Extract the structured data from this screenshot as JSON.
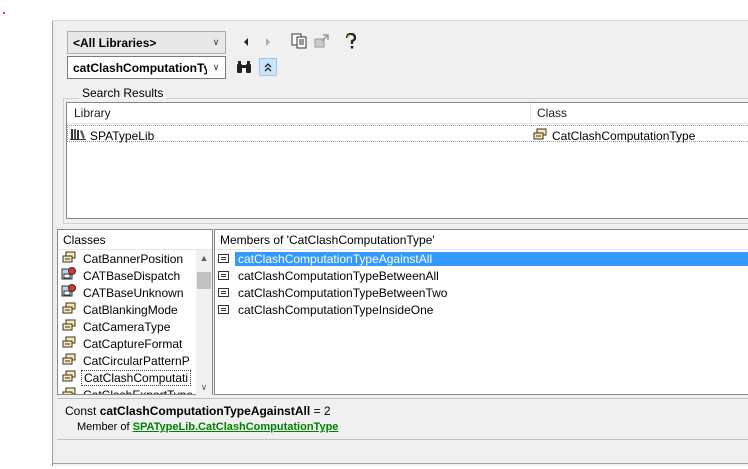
{
  "toolbar": {
    "library_combo_value": "<All Libraries>",
    "search_combo_value": "catClashComputationTyp",
    "nav_back_icon": "back-arrow-icon",
    "nav_forward_icon": "forward-arrow-icon",
    "copy_icon": "copy-to-clipboard-icon",
    "view_definition_icon": "view-definition-icon",
    "help_icon": "help-icon",
    "search_icon": "binoculars-icon",
    "toggle_results_icon": "show-hide-results-icon"
  },
  "search_results": {
    "group_label": "Search Results",
    "columns": [
      "Library",
      "Class"
    ],
    "rows": [
      {
        "library": "SPATypeLib",
        "class": "CatClashComputationType"
      }
    ]
  },
  "classes": {
    "title": "Classes",
    "items": [
      {
        "label": "CatBannerPosition",
        "icon": "enum-icon"
      },
      {
        "label": "CATBaseDispatch",
        "icon": "class-icon"
      },
      {
        "label": "CATBaseUnknown",
        "icon": "class-icon"
      },
      {
        "label": "CatBlankingMode",
        "icon": "enum-icon"
      },
      {
        "label": "CatCameraType",
        "icon": "enum-icon"
      },
      {
        "label": "CatCaptureFormat",
        "icon": "enum-icon"
      },
      {
        "label": "CatCircularPatternP",
        "icon": "enum-icon"
      },
      {
        "label": "CatClashComputati",
        "icon": "enum-icon",
        "selected": true
      },
      {
        "label": "CatClashExportType",
        "icon": "enum-icon"
      }
    ]
  },
  "members": {
    "title": "Members of 'CatClashComputationType'",
    "items": [
      {
        "label": "catClashComputationTypeAgainstAll",
        "selected": true
      },
      {
        "label": "catClashComputationTypeBetweenAll"
      },
      {
        "label": "catClashComputationTypeBetweenTwo"
      },
      {
        "label": "catClashComputationTypeInsideOne"
      }
    ]
  },
  "details": {
    "prefix": "Const ",
    "name": "catClashComputationTypeAgainstAll",
    "suffix": " = 2",
    "member_of_text": "Member of ",
    "library_link": "SPATypeLib",
    "dot": ".",
    "class_link": "CatClashComputationType"
  },
  "colors": {
    "selection": "#3399ff",
    "link": "#008000",
    "window_bg": "#f0f0f0"
  }
}
